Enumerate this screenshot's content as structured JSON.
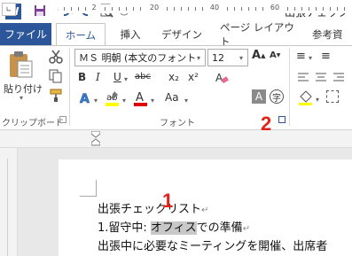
{
  "window": {
    "title": "出張チェック"
  },
  "quick_access": {
    "app_icon_letter": "W",
    "icons": [
      "save-icon",
      "undo-icon",
      "redo-icon",
      "print-preview-icon",
      "back-icon",
      "forward-icon"
    ]
  },
  "tabs": [
    "ファイル",
    "ホーム",
    "挿入",
    "デザイン",
    "ページ レイアウト",
    "参考資"
  ],
  "ribbon": {
    "clipboard": {
      "paste_label": "貼り付け",
      "group_label": "クリップボード"
    },
    "font": {
      "font_name": "ＭＳ 明朝 (本文のフォント",
      "font_size": "12",
      "group_label": "フォント",
      "bold": "B",
      "italic": "I",
      "underline": "U",
      "strike": "abc",
      "subscript": "x₂",
      "superscript": "x²",
      "grow": "A",
      "shrink": "A",
      "case": "Aa",
      "font_color": "A",
      "char_shade": "A",
      "enclose": "字"
    },
    "para_marks": [
      "≡",
      "≡"
    ]
  },
  "callouts": {
    "one": "1",
    "two": "2"
  },
  "ruler": {
    "numbers": [
      "2",
      "20",
      "40",
      "60"
    ]
  },
  "document": {
    "line1": "出張チェックリスト",
    "line2_prefix": "1.留守中: ",
    "line2_highlight": "オフィス",
    "line2_suffix": "での準備",
    "line3": "出張中に必要なミーティングを開催、出席者"
  },
  "colors": {
    "accent": "#2b579a",
    "callout": "#e0221a",
    "highlight": "#ffff00",
    "font_red": "#e00000"
  }
}
